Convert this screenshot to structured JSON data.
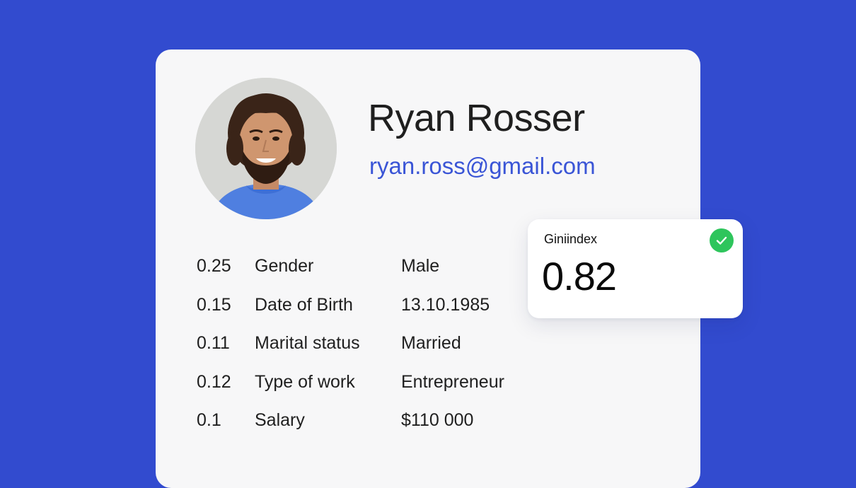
{
  "profile": {
    "name": "Ryan Rosser",
    "email": "ryan.ross@gmail.com"
  },
  "attributes": [
    {
      "weight": "0.25",
      "label": "Gender",
      "value": "Male"
    },
    {
      "weight": "0.15",
      "label": "Date of Birth",
      "value": "13.10.1985"
    },
    {
      "weight": "0.11",
      "label": "Marital status",
      "value": "Married"
    },
    {
      "weight": "0.12",
      "label": "Type of work",
      "value": "Entrepreneur"
    },
    {
      "weight": "0.1",
      "label": "Salary",
      "value": "$110 000"
    }
  ],
  "gini": {
    "title": "Giniindex",
    "value": "0.82",
    "status_icon": "check-circle-icon"
  },
  "colors": {
    "background": "#324bcf",
    "card": "#f7f7f8",
    "email": "#3a55d6",
    "check": "#2ec55c"
  }
}
